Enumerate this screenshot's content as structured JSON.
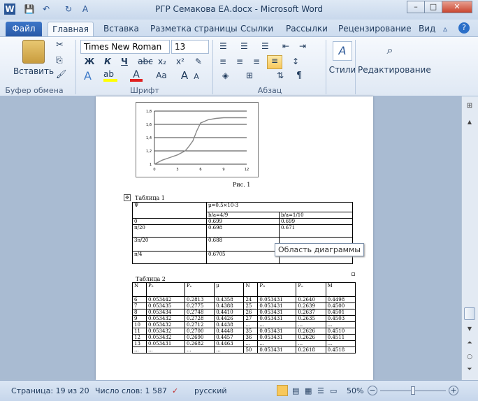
{
  "window": {
    "title": "РГР Семакова ЕА.docx  -  Microsoft Word",
    "minimize": "–",
    "maximize": "□",
    "close": "✕"
  },
  "qat": {
    "app": "W",
    "save": "💾",
    "undo": "↶",
    "redo": "↻",
    "format": "A"
  },
  "tabs": [
    "Файл",
    "Главная",
    "Вставка",
    "Разметка страницы",
    "Ссылки",
    "Рассылки",
    "Рецензирование",
    "Вид"
  ],
  "ribbon": {
    "paste_label": "Вставить",
    "font_name": "Times New Roman",
    "font_size": "13",
    "groups": {
      "clipboard": "Буфер обмена",
      "font": "Шрифт",
      "paragraph": "Абзац",
      "styles": "Стили",
      "editing": "Редактирование"
    },
    "bold": "Ж",
    "italic": "К",
    "underline": "Ч",
    "strike": "abc",
    "subscript": "x₂",
    "superscript": "x²",
    "grow_font": "A",
    "shrink_font": "A",
    "change_case": "Aa"
  },
  "document": {
    "chart_caption": "Рис. 1",
    "table1_caption": "Таблица 1",
    "table2_caption": "Таблица 2",
    "tooltip": "Область диаграммы",
    "table1": {
      "head": [
        "Ψ",
        "μ=0.5×10-3"
      ],
      "subhead": [
        "b/a=4/9",
        "b/a=1/10"
      ],
      "rows": [
        [
          "0",
          "0.699",
          "0.699"
        ],
        [
          "π/20",
          "0.698",
          "0.671"
        ],
        [
          "3π/20",
          "0.688",
          ""
        ],
        [
          "π/4",
          "0.6705",
          "0.4535"
        ]
      ]
    },
    "table2": {
      "headers": [
        "N",
        "P₀",
        "Pₑ",
        "μ",
        "N",
        "P₀",
        "Pₑ",
        "M"
      ],
      "rows": [
        [
          "6",
          "0.053442",
          "0.2813",
          "0.4358",
          "24",
          "0.053431",
          "0.2640",
          "0.4498"
        ],
        [
          "7",
          "0.053435",
          "0.2775",
          "0.4388",
          "25",
          "0.053431",
          "0.2639",
          "0.4500"
        ],
        [
          "8",
          "0.053434",
          "0.2748",
          "0.4410",
          "26",
          "0.053431",
          "0.2637",
          "0.4501"
        ],
        [
          "9",
          "0.053432",
          "0.2728",
          "0.4426",
          "27",
          "0.053431",
          "0.2635",
          "0.4503"
        ],
        [
          "10",
          "0.053432",
          "0.2712",
          "0.4438",
          "...",
          "...",
          "...",
          "..."
        ],
        [
          "11",
          "0.053432",
          "0.2700",
          "0.4448",
          "35",
          "0.053431",
          "0.2626",
          "0.4510"
        ],
        [
          "12",
          "0.053432",
          "0.2690",
          "0.4457",
          "36",
          "0.053431",
          "0.2626",
          "0.4511"
        ],
        [
          "13",
          "0.053431",
          "0.2682",
          "0.4463",
          "...",
          "...",
          "...",
          "..."
        ],
        [
          "...",
          "...",
          "...",
          "...",
          "50",
          "0.053431",
          "0.2618",
          "0.4518"
        ]
      ]
    }
  },
  "chart_data": {
    "type": "line",
    "x": [
      0,
      1,
      2,
      3,
      4,
      4.5,
      5,
      5.5,
      6,
      7,
      8,
      9,
      10,
      11,
      12
    ],
    "series": [
      {
        "values": [
          1.0,
          1.06,
          1.1,
          1.14,
          1.2,
          1.27,
          1.35,
          1.5,
          1.62,
          1.67,
          1.69,
          1.7,
          1.7,
          1.7,
          1.7
        ]
      }
    ],
    "xticks": [
      "0",
      "3",
      "6",
      "9",
      "12"
    ],
    "yticks": [
      "1",
      "1,2",
      "1,4",
      "1,6",
      "1,8"
    ],
    "xlim": [
      0,
      12
    ],
    "ylim": [
      1,
      1.8
    ],
    "grid": "horizontal"
  },
  "status": {
    "page": "Страница: 19 из 20",
    "words": "Число слов: 1 587",
    "lang": "русский",
    "zoom": "50%",
    "zoom_level": 0.5
  }
}
